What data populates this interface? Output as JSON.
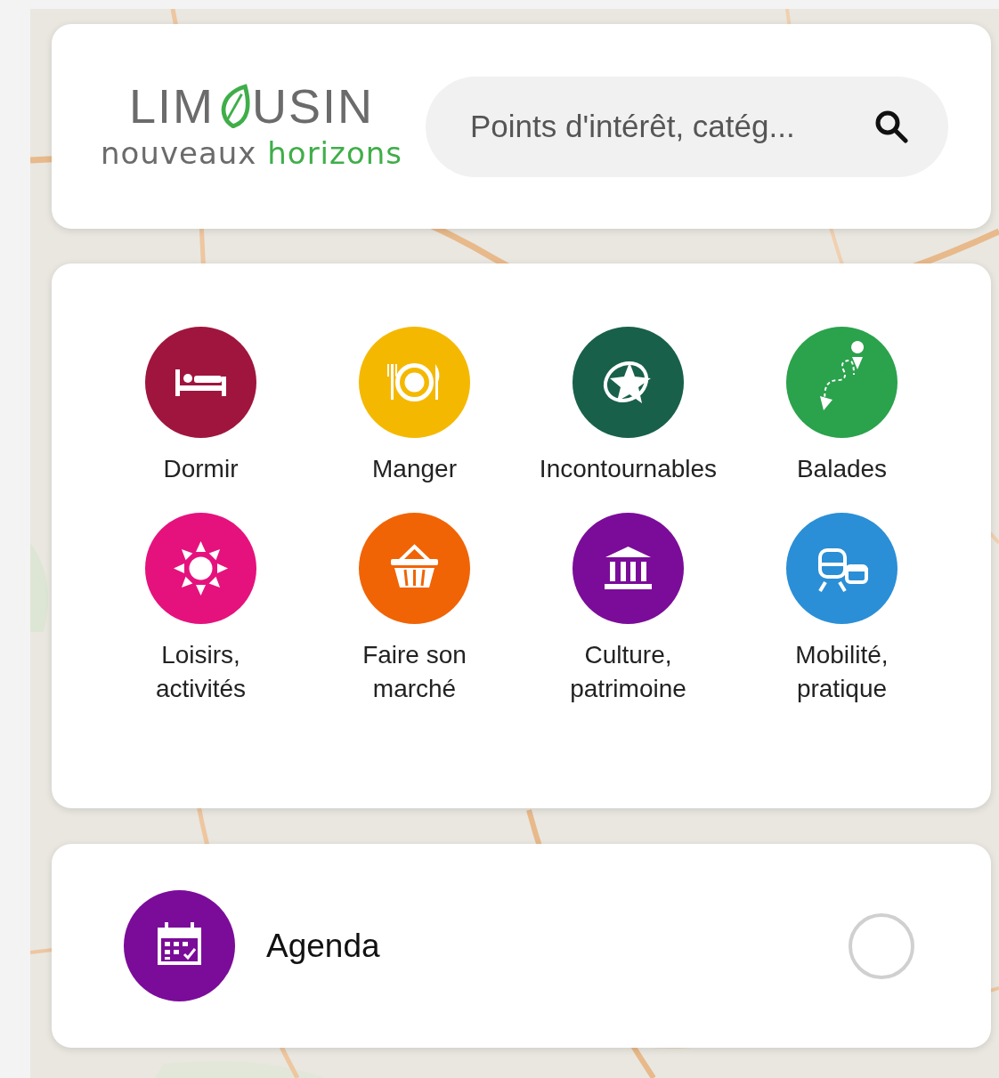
{
  "header": {
    "logo": {
      "word_start": "LIM",
      "word_end": "USIN",
      "tagline": "nouveaux **horizons**"
    },
    "search": {
      "placeholder": "Points d'intérêt, catég..."
    }
  },
  "categories": [
    {
      "label": "Dormir",
      "kind": "bed",
      "color": "#a0153e"
    },
    {
      "label": "Manger",
      "kind": "plate",
      "color": "#f5b800"
    },
    {
      "label": "Incontournables",
      "kind": "star",
      "color": "#18604a"
    },
    {
      "label": "Balades",
      "kind": "route",
      "color": "#2ba24c"
    },
    {
      "label": "Loisirs,\nactivités",
      "kind": "sun",
      "color": "#e5127d"
    },
    {
      "label": "Faire son\nmarché",
      "kind": "basket",
      "color": "#f06405"
    },
    {
      "label": "Culture,\npatrimoine",
      "kind": "museum",
      "color": "#7b0c99"
    },
    {
      "label": "Mobilité,\npratique",
      "kind": "transport",
      "color": "#2a8fd6"
    }
  ],
  "agenda": {
    "label": "Agenda",
    "color": "#7b0c99",
    "checked": false
  }
}
